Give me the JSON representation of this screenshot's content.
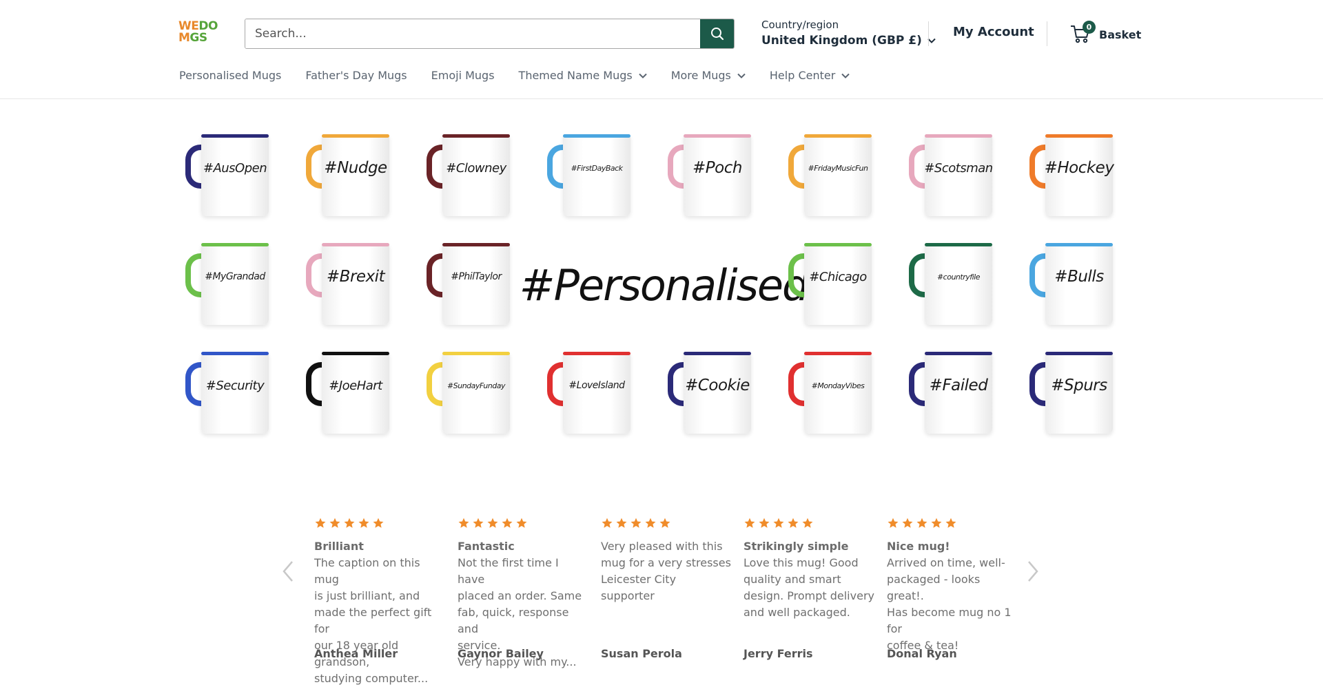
{
  "header": {
    "logo": {
      "line1_a": "WE",
      "line1_b": "DO",
      "line2_a": "M",
      "line2_b": "GS"
    },
    "search": {
      "placeholder": "Search..."
    },
    "country": {
      "label": "Country/region",
      "value": "United Kingdom (GBP £)"
    },
    "account_label": "My Account",
    "basket": {
      "count": "0",
      "label": "Basket"
    },
    "colors": {
      "accent": "#1c5a49",
      "logo_orange": "#e8892c",
      "logo_green": "#56a43a"
    }
  },
  "nav": {
    "items": [
      {
        "label": "Personalised Mugs",
        "has_dropdown": false
      },
      {
        "label": "Father's Day Mugs",
        "has_dropdown": false
      },
      {
        "label": "Emoji Mugs",
        "has_dropdown": false
      },
      {
        "label": "Themed Name Mugs",
        "has_dropdown": true
      },
      {
        "label": "More Mugs",
        "has_dropdown": true
      },
      {
        "label": "Help Center",
        "has_dropdown": true
      }
    ]
  },
  "banner": {
    "center_text": "#Personalised",
    "mugs": [
      {
        "text": "#AusOpen",
        "color": "#2b2a78"
      },
      {
        "text": "#Nudge",
        "color": "#f0a83a"
      },
      {
        "text": "#Clowney",
        "color": "#6a2327"
      },
      {
        "text": "#FirstDayBack",
        "color": "#4aa6e0"
      },
      {
        "text": "#Poch",
        "color": "#e7a8bd"
      },
      {
        "text": "#FridayMusicFun",
        "color": "#f0a83a"
      },
      {
        "text": "#Scotsman",
        "color": "#e7a8bd"
      },
      {
        "text": "#Hockey",
        "color": "#ef7b2a"
      },
      {
        "text": "#MyGrandad",
        "color": "#6cc04a"
      },
      {
        "text": "#Brexit",
        "color": "#e7a8bd"
      },
      {
        "text": "#PhilTaylor",
        "color": "#6a2327"
      },
      {
        "text": "#Chicago",
        "color": "#6cc04a"
      },
      {
        "text": "#countryfile",
        "color": "#1d6a47"
      },
      {
        "text": "#Bulls",
        "color": "#4aa6e0"
      },
      {
        "text": "#Security",
        "color": "#3156c8"
      },
      {
        "text": "#JoeHart",
        "color": "#111111"
      },
      {
        "text": "#SundayFunday",
        "color": "#f2d040"
      },
      {
        "text": "#LoveIsland",
        "color": "#e03030"
      },
      {
        "text": "#Cookie",
        "color": "#2b2a78"
      },
      {
        "text": "#MondayVibes",
        "color": "#e03030"
      },
      {
        "text": "#Failed",
        "color": "#2b2a78"
      },
      {
        "text": "#Spurs",
        "color": "#2b2a78"
      }
    ]
  },
  "reviews": {
    "star_color": "#f08c2a",
    "items": [
      {
        "rating": 5,
        "title": "Brilliant",
        "text": [
          "The caption on this mug",
          "is just brilliant, and",
          "made the perfect gift for",
          "our 18 year old grandson,",
          "studying computer..."
        ],
        "author": "Anthea Miller"
      },
      {
        "rating": 5,
        "title": "Fantastic",
        "text": [
          "Not the first time I have",
          "placed an order. Same",
          "fab, quick, response and",
          "service.",
          "Very happy with my..."
        ],
        "author": "Gaynor Bailey"
      },
      {
        "rating": 5,
        "title": "",
        "text": [
          "Very pleased with this",
          "mug for a very stresses",
          "Leicester City supporter"
        ],
        "author": "Susan Perola"
      },
      {
        "rating": 5,
        "title": "Strikingly simple",
        "text": [
          "Love this mug! Good",
          "quality and smart",
          "design. Prompt delivery",
          "and well packaged."
        ],
        "author": "Jerry Ferris"
      },
      {
        "rating": 5,
        "title": "Nice mug!",
        "text": [
          "Arrived on time, well-",
          "packaged - looks great!.",
          "Has become mug no 1 for",
          "coffee & tea!"
        ],
        "author": "Donal Ryan"
      }
    ]
  }
}
